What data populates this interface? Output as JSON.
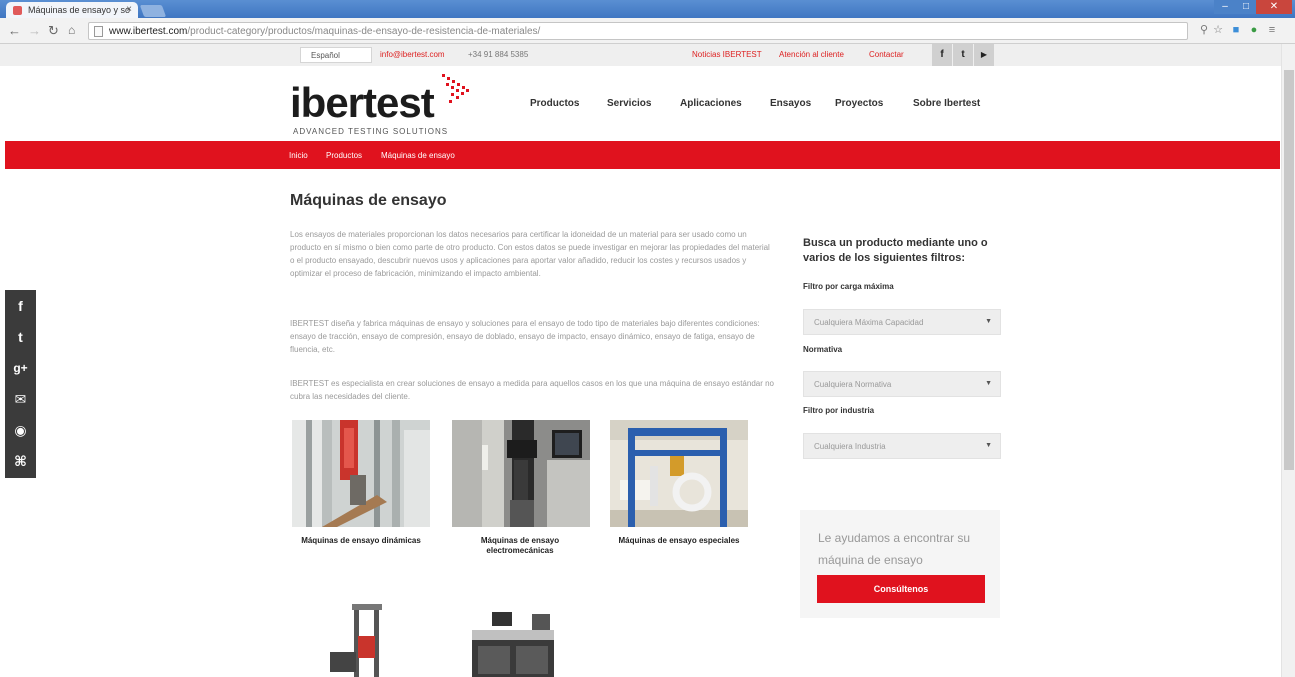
{
  "browser": {
    "tab_title": "Máquinas de ensayo y so",
    "tab_close": "×",
    "url_domain": "www.ibertest.com",
    "url_path": "/product-category/productos/maquinas-de-ensayo-de-resistencia-de-materiales/"
  },
  "topbar": {
    "language": "Español",
    "email": "info@ibertest.com",
    "phone": "+34 91 884 5385",
    "links": [
      "Noticias IBERTEST",
      "Atención al cliente",
      "Contactar"
    ],
    "social": [
      "f",
      "t",
      "▶"
    ]
  },
  "header": {
    "logo": "ibertest",
    "tagline": "ADVANCED TESTING SOLUTIONS",
    "nav": [
      "Productos",
      "Servicios",
      "Aplicaciones",
      "Ensayos",
      "Proyectos",
      "Sobre Ibertest"
    ]
  },
  "breadcrumb": [
    "Inicio",
    "Productos",
    "Máquinas de ensayo"
  ],
  "main": {
    "title": "Máquinas de ensayo",
    "paragraphs": [
      "Los ensayos de materiales proporcionan los datos necesarios para certificar la idoneidad de un material para ser usado como un producto en sí mismo o bien como parte de otro producto. Con estos datos se puede investigar en mejorar las propiedades del material o el producto ensayado, descubrir nuevos usos y aplicaciones para aportar valor añadido, reducir los costes y recursos usados y optimizar el proceso de fabricación, minimizando el impacto ambiental.",
      "IBERTEST diseña y fabrica máquinas de ensayo y soluciones para el ensayo de todo tipo de materiales bajo diferentes condiciones: ensayo de tracción, ensayo de compresión, ensayo de doblado, ensayo de impacto, ensayo dinámico, ensayo de fatiga, ensayo de fluencia, etc.",
      "IBERTEST es especialista en crear soluciones de ensayo a medida para aquellos casos en los que una máquina de ensayo estándar no cubra las necesidades del cliente."
    ],
    "products": [
      {
        "caption": "Máquinas de ensayo dinámicas"
      },
      {
        "caption": "Máquinas de ensayo electromecánicas"
      },
      {
        "caption": "Máquinas de ensayo especiales"
      }
    ]
  },
  "filters": {
    "heading": "Busca un producto mediante uno o varios de los siguientes filtros:",
    "items": [
      {
        "label": "Filtro por carga máxima",
        "value": "Cualquiera Máxima Capacidad"
      },
      {
        "label": "Normativa",
        "value": "Cualquiera Normativa"
      },
      {
        "label": "Filtro por industria",
        "value": "Cualquiera Industria"
      }
    ],
    "caret": "▼"
  },
  "help": {
    "text": "Le ayudamos a encontrar su máquina de ensayo",
    "button": "Consúltenos"
  },
  "side_social": [
    "f",
    "t",
    "g+",
    "✉",
    "◉",
    "⌘"
  ],
  "colors": {
    "brand_red": "#e0121e"
  }
}
